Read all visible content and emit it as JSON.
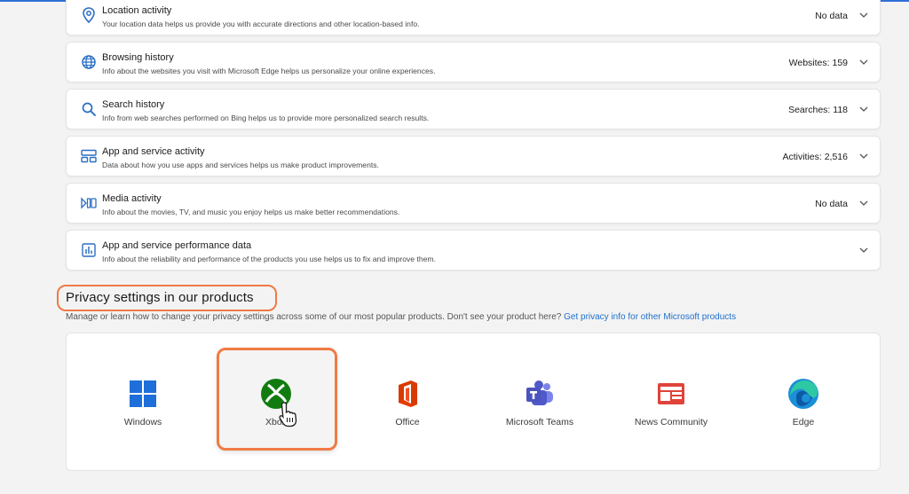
{
  "activity_cards": [
    {
      "icon": "location-pin-icon",
      "title": "Location activity",
      "desc": "Your location data helps us provide you with accurate directions and other location-based info.",
      "value": "No data"
    },
    {
      "icon": "globe-icon",
      "title": "Browsing history",
      "desc": "Info about the websites you visit with Microsoft Edge helps us personalize your online experiences.",
      "value": "Websites: 159"
    },
    {
      "icon": "search-icon",
      "title": "Search history",
      "desc": "Info from web searches performed on Bing helps us to provide more personalized search results.",
      "value": "Searches: 118"
    },
    {
      "icon": "apps-icon",
      "title": "App and service activity",
      "desc": "Data about how you use apps and services helps us make product improvements.",
      "value": "Activities: 2,516"
    },
    {
      "icon": "media-icon",
      "title": "Media activity",
      "desc": "Info about the movies, TV, and music you enjoy helps us make better recommendations.",
      "value": "No data"
    },
    {
      "icon": "performance-icon",
      "title": "App and service performance data",
      "desc": "Info about the reliability and performance of the products you use helps us to fix and improve them.",
      "value": ""
    }
  ],
  "privacy_section": {
    "title": "Privacy settings in our products",
    "desc": "Manage or learn how to change your privacy settings across some of our most popular products. Don't see your product here?",
    "link": "Get privacy info for other Microsoft products"
  },
  "products": [
    {
      "name": "Windows",
      "icon": "windows-logo-icon"
    },
    {
      "name": "Xbox",
      "icon": "xbox-logo-icon"
    },
    {
      "name": "Office",
      "icon": "office-logo-icon"
    },
    {
      "name": "Microsoft Teams",
      "icon": "teams-logo-icon"
    },
    {
      "name": "News Community",
      "icon": "news-logo-icon"
    },
    {
      "name": "Edge",
      "icon": "edge-logo-icon"
    }
  ],
  "colors": {
    "accent": "#2f6fd6",
    "highlight": "#f07a45",
    "link": "#1f6fcb"
  }
}
